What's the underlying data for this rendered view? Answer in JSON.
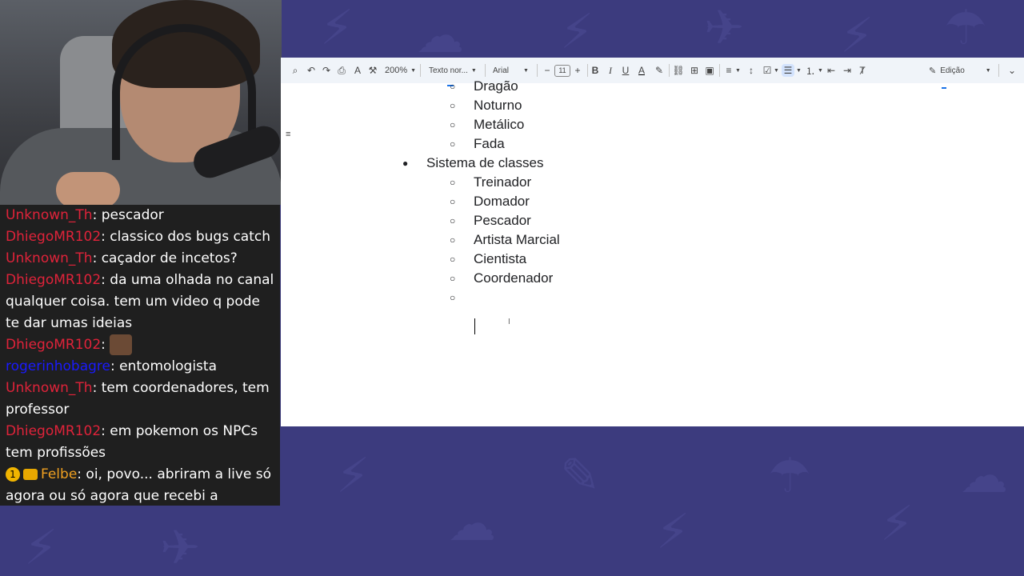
{
  "chat": {
    "messages": [
      {
        "user": "Unknown_Th",
        "color": "#e0233a",
        "text": ": pescador"
      },
      {
        "user": "DhiegoMR102",
        "color": "#e0233a",
        "text": ": classico dos bugs catch"
      },
      {
        "user": "Unknown_Th",
        "color": "#e0233a",
        "text": ": caçador de incetos?"
      },
      {
        "user": "DhiegoMR102",
        "color": "#e0233a",
        "text": ": da uma olhada no canal qualquer coisa. tem um video q pode te dar umas ideias"
      },
      {
        "user": "DhiegoMR102",
        "color": "#e0233a",
        "text": ":"
      },
      {
        "user": "rogerinhobagre",
        "color": "#1a1aff",
        "text": ": entomologista"
      },
      {
        "user": "Unknown_Th",
        "color": "#e0233a",
        "text": ": tem coordenadores, tem professor"
      },
      {
        "user": "DhiegoMR102",
        "color": "#e0233a",
        "text": ": em pokemon os NPCs tem profissões"
      },
      {
        "user": "Felbe",
        "color": "#f0a020",
        "text": ": oi, povo... abriram a live só agora ou só agora que recebi a"
      }
    ],
    "badge_number": "1"
  },
  "toolbar": {
    "zoom": "200%",
    "style": "Texto nor...",
    "font": "Arial",
    "font_size": "11",
    "mode": "Edição",
    "icons": [
      "search-icon",
      "undo-icon",
      "redo-icon",
      "print-icon",
      "spellcheck-icon",
      "paint-format-icon",
      "bold-icon",
      "italic-icon",
      "underline-icon",
      "text-color-icon",
      "highlight-icon",
      "link-icon",
      "comment-icon",
      "image-icon",
      "align-icon",
      "line-spacing-icon",
      "checklist-icon",
      "bulleted-list-icon",
      "numbered-list-icon",
      "decrease-indent-icon",
      "increase-indent-icon",
      "clear-formatting-icon",
      "pencil-icon",
      "chevron-down-icon"
    ]
  },
  "document": {
    "items": [
      {
        "level": 2,
        "text": "Dragão"
      },
      {
        "level": 2,
        "text": "Noturno"
      },
      {
        "level": 2,
        "text": "Metálico"
      },
      {
        "level": 2,
        "text": "Fada"
      },
      {
        "level": 1,
        "text": "Sistema de classes"
      },
      {
        "level": 2,
        "text": "Treinador"
      },
      {
        "level": 2,
        "text": "Domador"
      },
      {
        "level": 2,
        "text": "Pescador"
      },
      {
        "level": 2,
        "text": "Artista Marcial"
      },
      {
        "level": 2,
        "text": "Cientista"
      },
      {
        "level": 2,
        "text": "Coordenador"
      },
      {
        "level": 2,
        "text": ""
      }
    ]
  }
}
